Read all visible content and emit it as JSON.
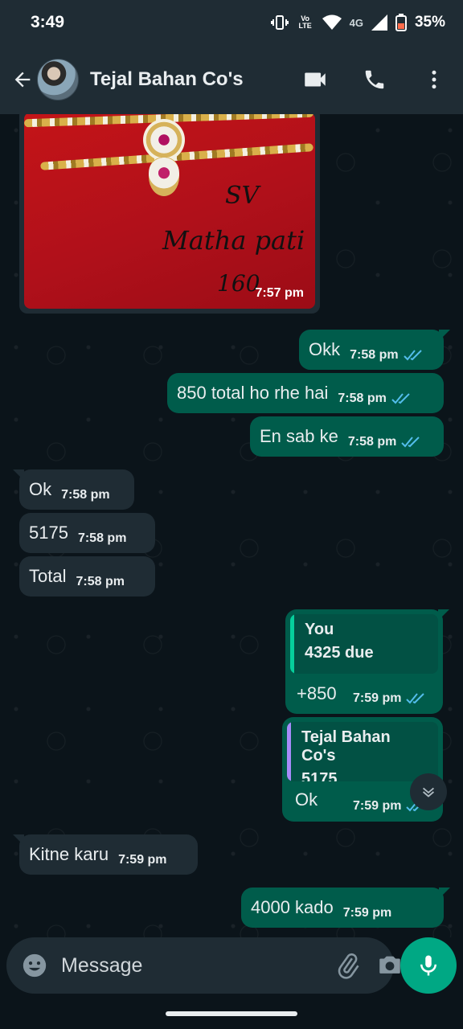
{
  "status_bar": {
    "time": "3:49",
    "volte": "Vo LTE",
    "network": "4G",
    "battery": "35%"
  },
  "header": {
    "contact_name": "Tejal Bahan Co's"
  },
  "media": {
    "handwriting_line1": "SV",
    "handwriting_line2": "Matha pati",
    "handwriting_line3": "160",
    "time": "7:57 pm"
  },
  "messages": [
    {
      "text": "Okk",
      "time": "7:58 pm"
    },
    {
      "text": "850 total ho rhe hai",
      "time": "7:58 pm"
    },
    {
      "text": "En sab ke",
      "time": "7:58 pm"
    },
    {
      "text": "Ok",
      "time": "7:58 pm"
    },
    {
      "text": "5175",
      "time": "7:58 pm"
    },
    {
      "text": "Total",
      "time": "7:58 pm"
    },
    {
      "text": "Kitne karu",
      "time": "7:59 pm"
    },
    {
      "text": "4000 kado",
      "time": "7:59 pm"
    }
  ],
  "replies": [
    {
      "quote_name": "You",
      "quote_text": "4325 due",
      "text": "+850",
      "time": "7:59 pm",
      "bar_color": "#06cf9c"
    },
    {
      "quote_name": "Tejal Bahan Co's",
      "quote_text": "5175",
      "text": "Ok",
      "time": "7:59 pm",
      "bar_color": "#a78bfa"
    }
  ],
  "composer": {
    "placeholder": "Message"
  },
  "colors": {
    "outgoing": "#005c4b",
    "incoming": "#1f2c34",
    "accent": "#00a884",
    "read_tick": "#53bdeb"
  },
  "icons": [
    "back-arrow-icon",
    "video-call-icon",
    "phone-icon",
    "more-vert-icon",
    "emoji-icon",
    "attach-icon",
    "camera-icon",
    "mic-icon",
    "chevron-down-icon",
    "double-tick-icon"
  ]
}
